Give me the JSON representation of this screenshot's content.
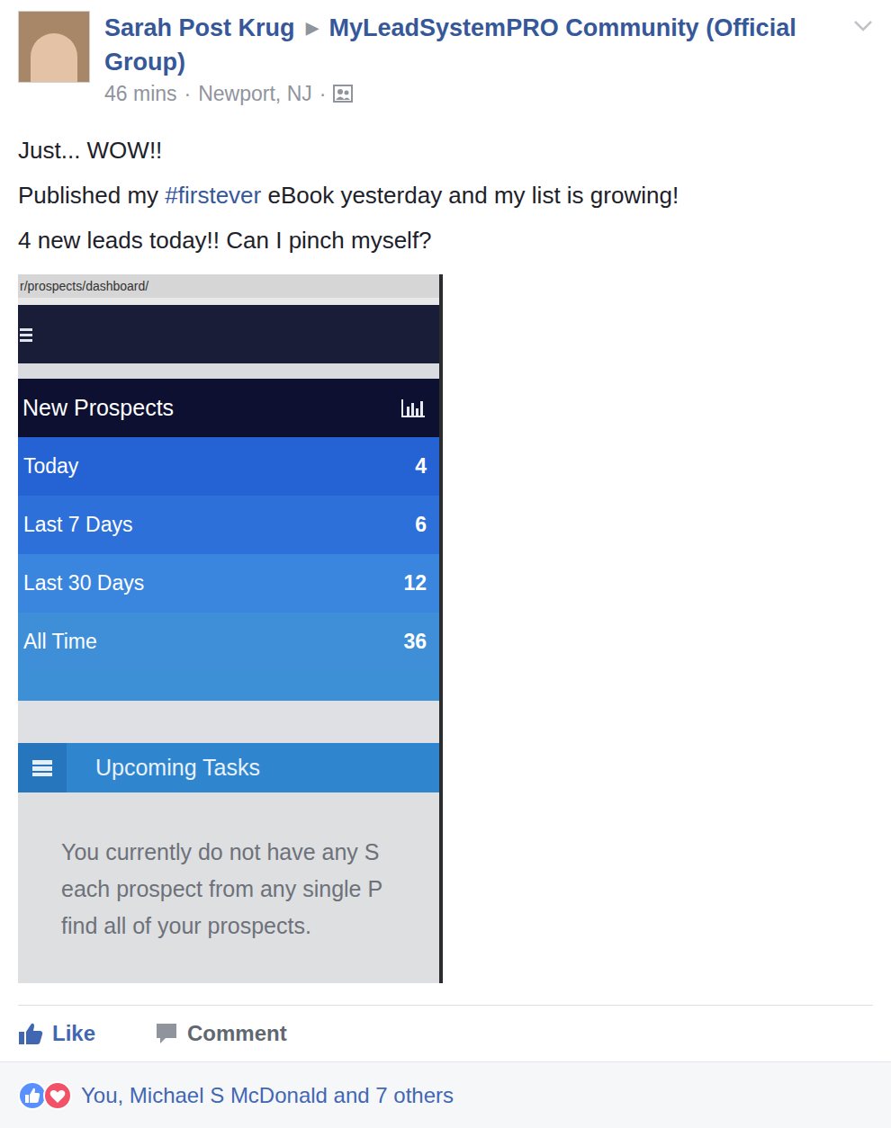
{
  "post": {
    "author": "Sarah Post Krug",
    "separator": "▶",
    "group": "MyLeadSystemPRO Community (Official Group)",
    "time": "46 mins",
    "dot1": "·",
    "location": "Newport, NJ",
    "dot2": "·",
    "lines": [
      [
        {
          "text": "Just... WOW!!",
          "link": false
        }
      ],
      [
        {
          "text": "Published my ",
          "link": false
        },
        {
          "text": "#firstever",
          "link": true
        },
        {
          "text": " eBook yesterday and my list is growing!",
          "link": false
        }
      ],
      [
        {
          "text": "4 new leads today!! Can I pinch myself?",
          "link": false
        }
      ]
    ]
  },
  "photo": {
    "url": "r/prospects/dashboard/",
    "panel_title": "New Prospects",
    "rows": [
      {
        "label": "Today",
        "count": "4"
      },
      {
        "label": "Last 7 Days",
        "count": "6"
      },
      {
        "label": "Last 30 Days",
        "count": "12"
      },
      {
        "label": "All Time",
        "count": "36"
      }
    ],
    "tasks_title": "Upcoming Tasks",
    "tasks_lines": [
      "You currently do not have any S",
      "each prospect from any single P",
      "find all of your prospects."
    ]
  },
  "actions": [
    {
      "label": "Like",
      "selected": true
    },
    {
      "label": "Comment",
      "selected": false
    }
  ],
  "reactions": {
    "text": "You, Michael S McDonald and 7 others"
  }
}
